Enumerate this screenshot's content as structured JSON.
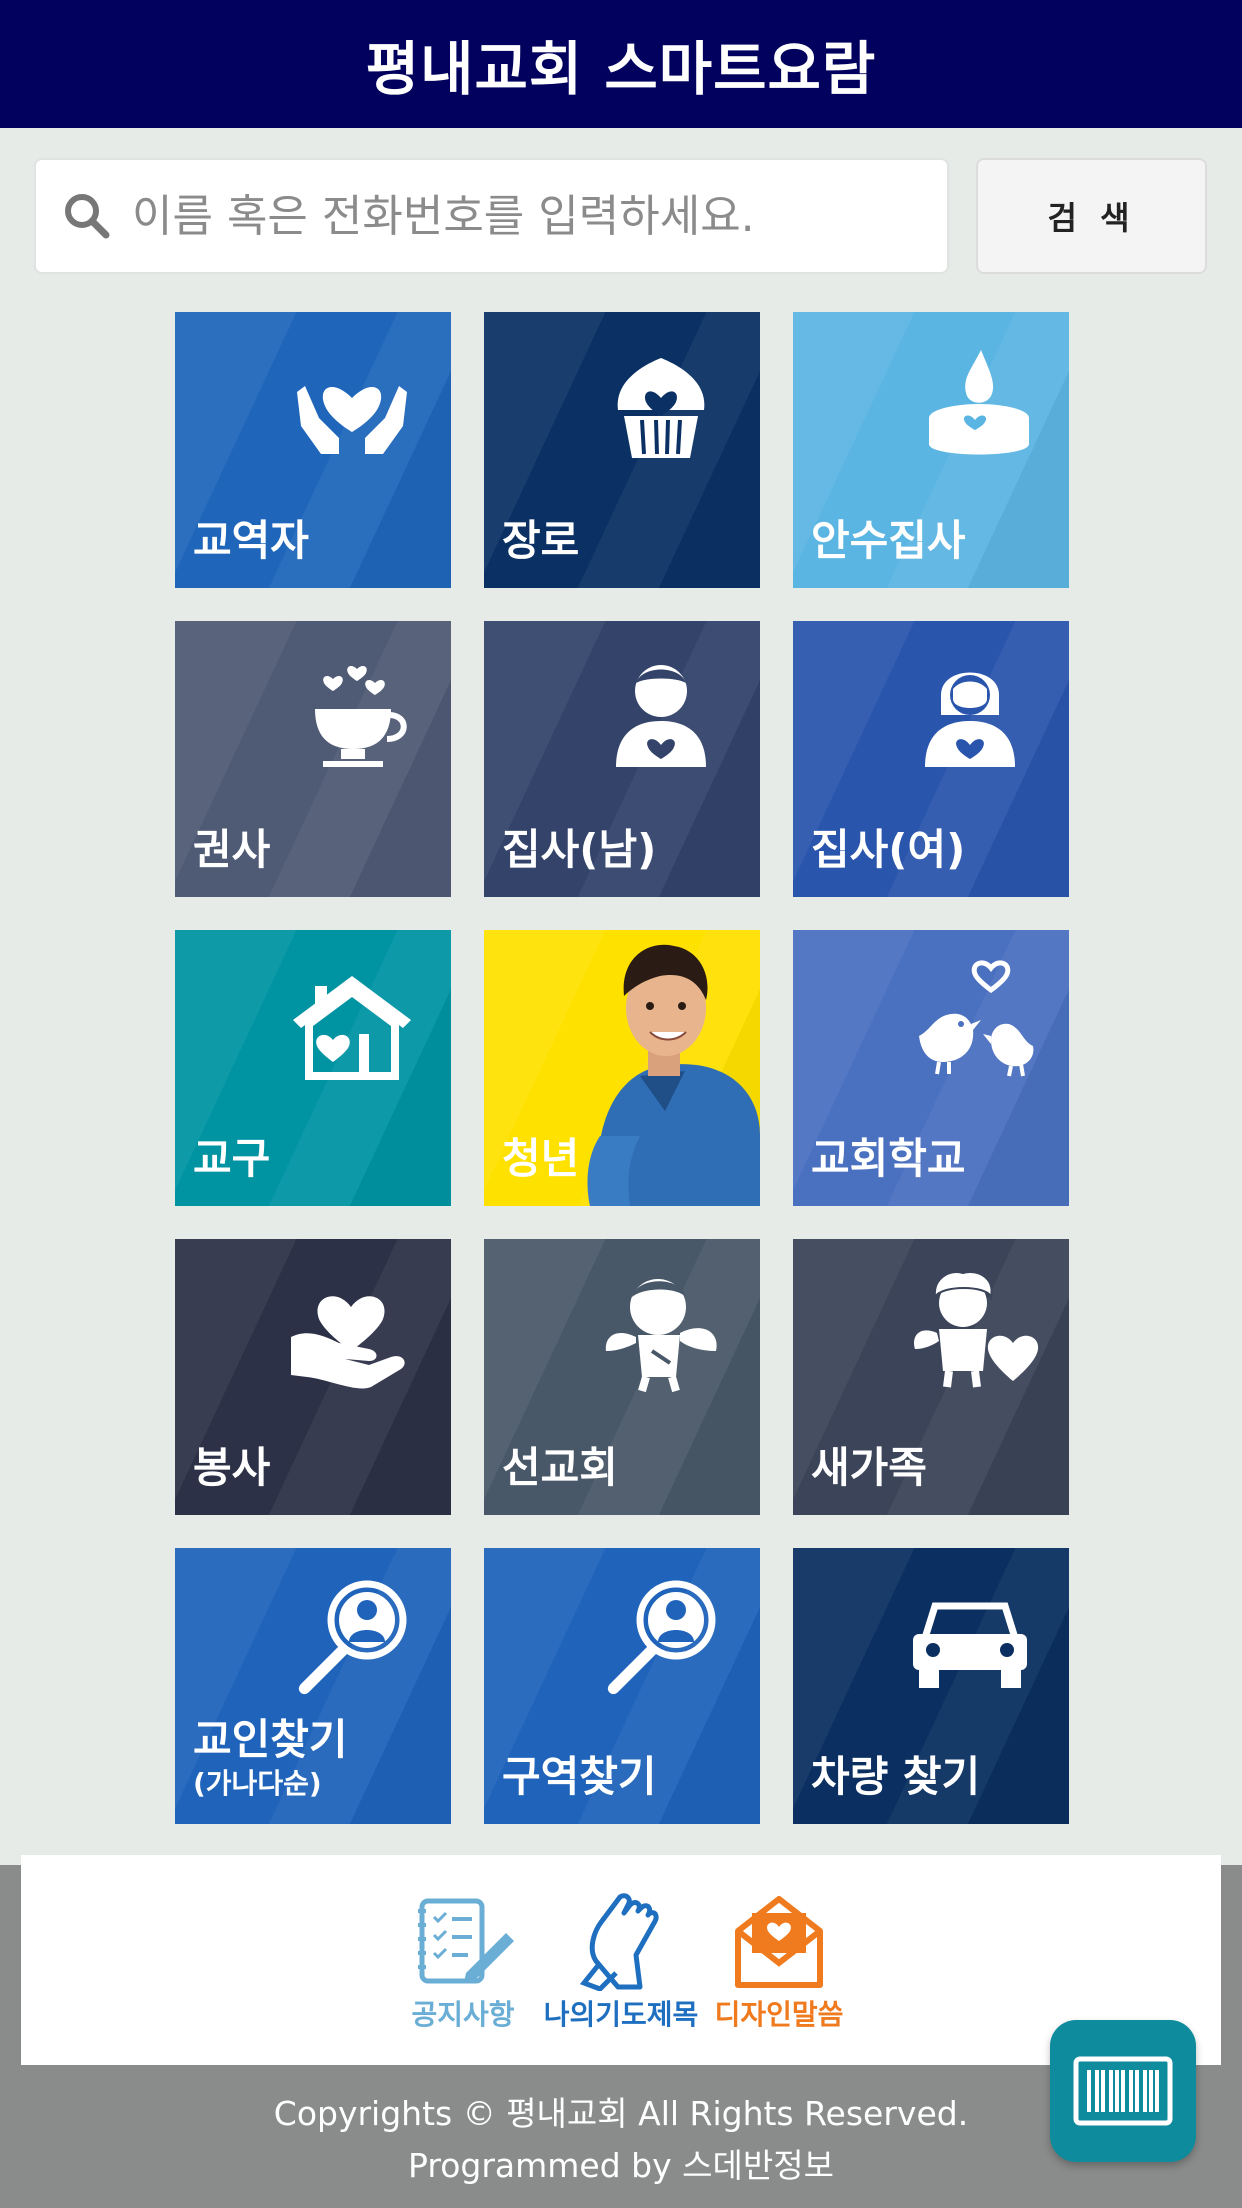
{
  "header": {
    "title": "평내교회 스마트요람"
  },
  "search": {
    "placeholder": "이름 혹은 전화번호를 입력하세요.",
    "button_label": "검 색"
  },
  "tiles": [
    {
      "label": "교역자",
      "color": "#1f66bb",
      "icon": "heart-hands-icon"
    },
    {
      "label": "장로",
      "color": "#0b3164",
      "icon": "cupcake-heart-icon"
    },
    {
      "label": "안수집사",
      "color": "#5bb5e2",
      "icon": "candle-icon"
    },
    {
      "label": "권사",
      "color": "#4f5a74",
      "icon": "coffee-cup-icon"
    },
    {
      "label": "집사(남)",
      "color": "#33436a",
      "icon": "man-heart-icon"
    },
    {
      "label": "집사(여)",
      "color": "#2a55ad",
      "icon": "woman-heart-icon"
    },
    {
      "label": "교구",
      "color": "#0094a3",
      "icon": "house-heart-icon"
    },
    {
      "label": "청년",
      "color": "#ffe100",
      "icon": "young-man-photo"
    },
    {
      "label": "교회학교",
      "color": "#4a70c0",
      "icon": "love-birds-icon"
    },
    {
      "label": "봉사",
      "color": "#2d3147",
      "icon": "heart-in-hand-icon"
    },
    {
      "label": "선교회",
      "color": "#495868",
      "icon": "cupid-angel-icon"
    },
    {
      "label": "새가족",
      "color": "#3b4458",
      "icon": "angel-heart-icon"
    },
    {
      "label": "교인찾기",
      "sub": "(가나다순)",
      "color": "#1f63ba",
      "icon": "magnifier-person-icon"
    },
    {
      "label": "구역찾기",
      "color": "#1f63ba",
      "icon": "magnifier-person-icon"
    },
    {
      "label": "차량 찾기",
      "color": "#0a2f60",
      "icon": "car-icon"
    }
  ],
  "footer_menu": [
    {
      "label": "공지사항",
      "color": "#6aaed6",
      "icon": "notepad-pencil-icon"
    },
    {
      "label": "나의기도제목",
      "color": "#1f6fc0",
      "icon": "praying-hands-icon"
    },
    {
      "label": "디자인말씀",
      "color": "#f07a1e",
      "icon": "envelope-heart-icon"
    }
  ],
  "copyright": {
    "line1": "Copyrights © 평내교회 All Rights Reserved.",
    "line2": "Programmed by 스데반정보"
  },
  "barcode_button": {
    "icon": "barcode-icon",
    "color": "#0e8b9c"
  }
}
